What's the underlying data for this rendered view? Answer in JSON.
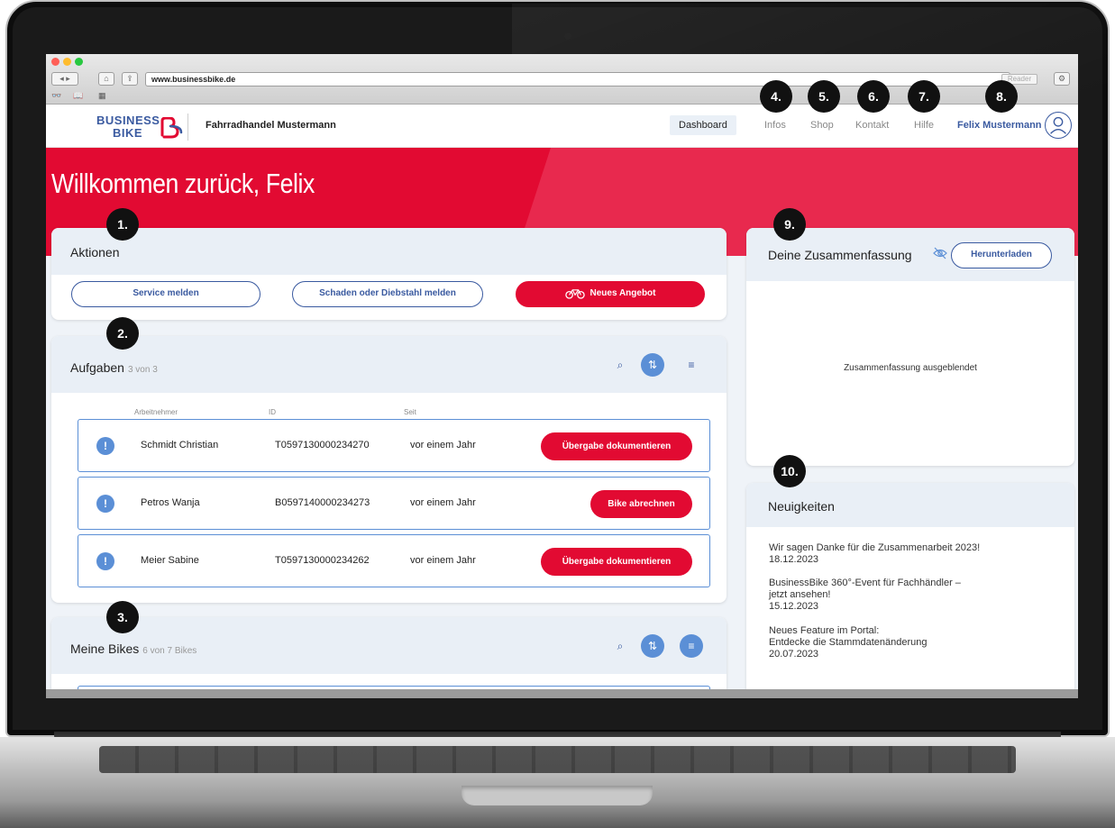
{
  "browser": {
    "url": "www.businessbike.de",
    "reader_label": "Reader"
  },
  "header": {
    "logo_line1": "BUSINESS",
    "logo_line2": "BIKE",
    "company": "Fahrradhandel Mustermann",
    "nav": {
      "dashboard": "Dashboard",
      "infos": "Infos",
      "shop": "Shop",
      "kontakt": "Kontakt",
      "hilfe": "Hilfe",
      "user": "Felix Mustermann"
    }
  },
  "markers": [
    "1.",
    "2.",
    "3.",
    "4.",
    "5.",
    "6.",
    "7.",
    "8.",
    "9.",
    "10."
  ],
  "hero": {
    "title": "Willkommen zurück, Felix"
  },
  "actions": {
    "title": "Aktionen",
    "buttons": [
      "Service melden",
      "Schaden oder Diebstahl melden",
      "Neues Angebot"
    ]
  },
  "tasks": {
    "title": "Aufgaben",
    "count": "3 von 3",
    "columns": [
      "Arbeitnehmer",
      "ID",
      "Seit"
    ],
    "rows": [
      {
        "name": "Schmidt Christian",
        "id": "T0597130000234270",
        "since": "vor einem Jahr",
        "action": "Übergabe dokumentieren"
      },
      {
        "name": "Petros Wanja",
        "id": "B0597140000234273",
        "since": "vor einem Jahr",
        "action": "Bike abrechnen"
      },
      {
        "name": "Meier Sabine",
        "id": "T0597130000234262",
        "since": "vor einem Jahr",
        "action": "Übergabe dokumentieren"
      }
    ]
  },
  "bikes": {
    "title": "Meine Bikes",
    "count": "6 von 7 Bikes"
  },
  "summary": {
    "title": "Deine Zusammenfassung",
    "download": "Herunterladen",
    "empty": "Zusammenfassung ausgeblendet"
  },
  "news": {
    "title": "Neuigkeiten",
    "items": [
      "Wir sagen Danke für die Zusammenarbeit 2023!\n18.12.2023",
      "BusinessBike 360°-Event für Fachhändler –\njetzt ansehen!\n15.12.2023",
      "Neues Feature im Portal:\nEntdecke die Stammdatenänderung\n20.07.2023"
    ]
  },
  "colors": {
    "brand_red": "#e20a32",
    "brand_blue": "#3a5aa0",
    "accent_blue": "#5b8fd6",
    "panel_bg": "#eff3f8"
  }
}
